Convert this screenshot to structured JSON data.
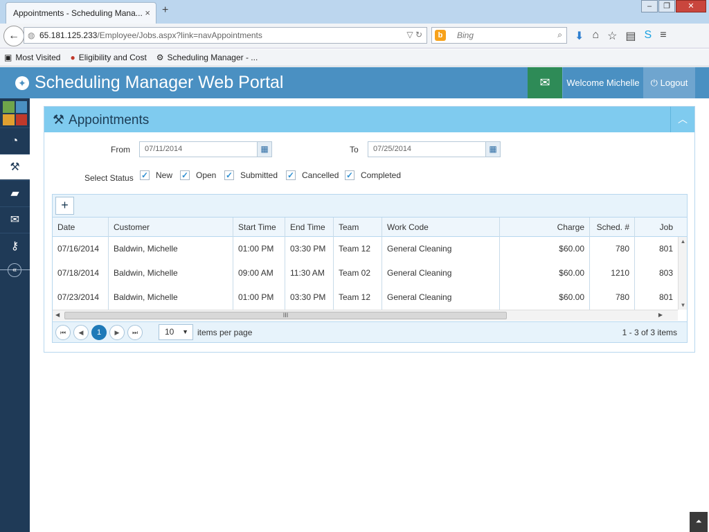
{
  "browser": {
    "tab_title": "Appointments - Scheduling Mana...",
    "tab_close": "×",
    "new_tab": "+",
    "url_host": "65.181.125.233",
    "url_path": "/Employee/Jobs.aspx?link=navAppointments",
    "search_placeholder": "Bing",
    "bookmarks": [
      "Most Visited",
      "Eligibility and Cost",
      "Scheduling Manager - ..."
    ]
  },
  "header": {
    "title": "Scheduling Manager Web Portal",
    "welcome": "Welcome Michelle",
    "logout": "Logout"
  },
  "panel": {
    "title": "Appointments",
    "from_label": "From",
    "from_value": "07/11/2014",
    "to_label": "To",
    "to_value": "07/25/2014",
    "status_label": "Select Status",
    "statuses": [
      {
        "label": "New",
        "checked": true
      },
      {
        "label": "Open",
        "checked": true
      },
      {
        "label": "Submitted",
        "checked": true
      },
      {
        "label": "Cancelled",
        "checked": true
      },
      {
        "label": "Completed",
        "checked": true
      }
    ]
  },
  "grid": {
    "add_label": "+",
    "columns": [
      "Date",
      "Customer",
      "Start Time",
      "End Time",
      "Team",
      "Work Code",
      "Charge",
      "Sched. #",
      "Job"
    ],
    "rows": [
      [
        "07/16/2014",
        "Baldwin, Michelle",
        "01:00 PM",
        "03:30 PM",
        "Team 12",
        "General Cleaning",
        "$60.00",
        "780",
        "801"
      ],
      [
        "07/18/2014",
        "Baldwin, Michelle",
        "09:00 AM",
        "11:30 AM",
        "Team 02",
        "General Cleaning",
        "$60.00",
        "1210",
        "803"
      ],
      [
        "07/23/2014",
        "Baldwin, Michelle",
        "01:00 PM",
        "03:30 PM",
        "Team 12",
        "General Cleaning",
        "$60.00",
        "780",
        "801"
      ]
    ],
    "scroll_grip": "III",
    "pager": {
      "current_page": "1",
      "page_size": "10",
      "items_label": "items per page",
      "info": "1 - 3 of 3 items"
    }
  }
}
